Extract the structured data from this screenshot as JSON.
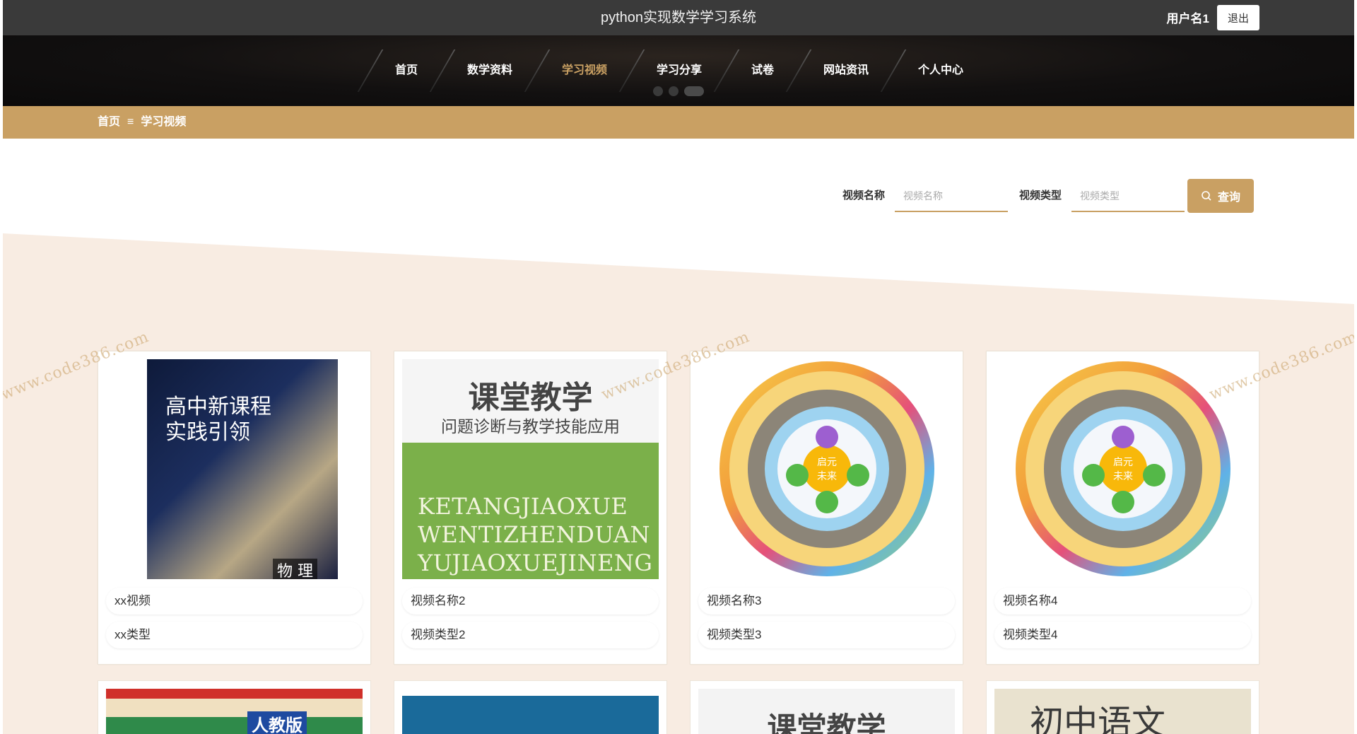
{
  "header": {
    "title": "python实现数学学习系统",
    "user": "用户名1",
    "logout": "退出"
  },
  "nav": {
    "items": [
      {
        "label": "首页"
      },
      {
        "label": "数学资料"
      },
      {
        "label": "学习视频",
        "active": true
      },
      {
        "label": "学习分享"
      },
      {
        "label": "试卷"
      },
      {
        "label": "网站资讯"
      },
      {
        "label": "个人中心"
      }
    ]
  },
  "breadcrumb": {
    "home": "首页",
    "separator": "≡",
    "current": "学习视频"
  },
  "search": {
    "name_label": "视频名称",
    "name_placeholder": "视频名称",
    "type_label": "视频类型",
    "type_placeholder": "视频类型",
    "button": "查询"
  },
  "videos": [
    {
      "name": "xx视频",
      "type": "xx类型",
      "cover": "高中新课程实践引领 物理"
    },
    {
      "name": "视频名称2",
      "type": "视频类型2",
      "cover": "课堂教学 问题诊断与教学技能应用"
    },
    {
      "name": "视频名称3",
      "type": "视频类型3",
      "cover": "启元未来 课程轮"
    },
    {
      "name": "视频名称4",
      "type": "视频类型4",
      "cover": "启元未来 课程轮"
    }
  ],
  "covers": {
    "physics_title": "高中新课程\n实践引领",
    "physics_subject": "物 理",
    "class_title": "课堂教学",
    "class_sub": "问题诊断与教学技能应用",
    "class_pinyin": "KETANGJIAOXUE\nWENTIZHENDUAN\nYUJIAOXUEJINENG",
    "wheel_center": "启元\n未来",
    "bottom_1": "人教版",
    "bottom_3": "课堂教学",
    "bottom_4": "初中语文"
  },
  "watermark": "www.code386.com",
  "colors": {
    "accent": "#c9a063",
    "topbar": "#3a3a3a",
    "bg_peach": "#f8ece2"
  }
}
